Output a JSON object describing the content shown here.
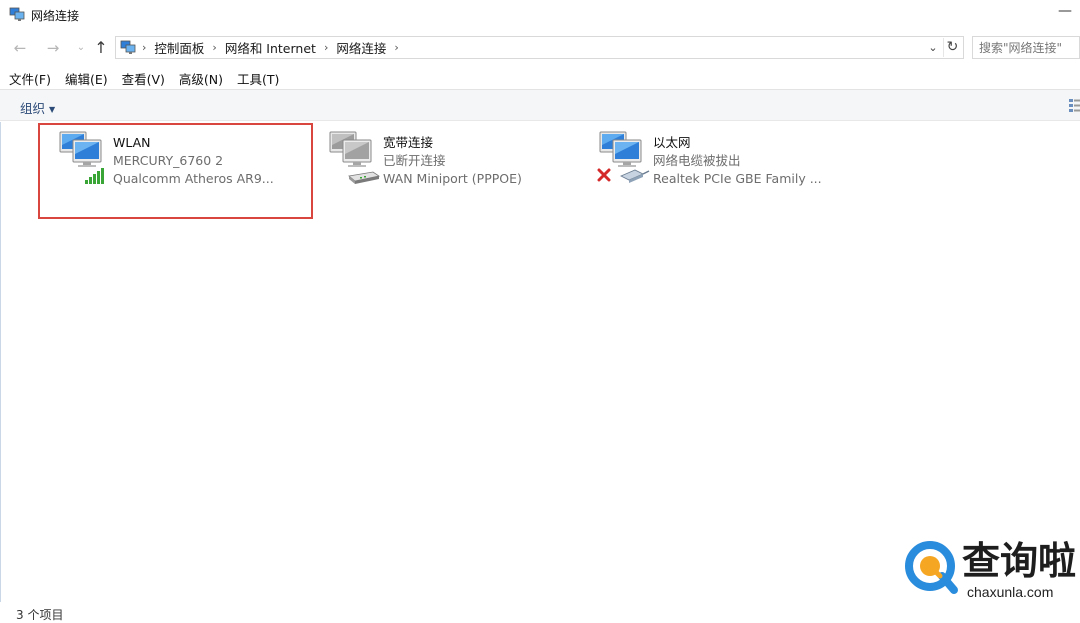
{
  "window": {
    "title": "网络连接",
    "minimize_glyph": "—"
  },
  "nav": {
    "back_glyph": "←",
    "forward_glyph": "→",
    "recent_glyph": "⌄",
    "up_glyph": "↑"
  },
  "address": {
    "crumbs": [
      "控制面板",
      "网络和 Internet",
      "网络连接"
    ],
    "separator": "›",
    "dropdown_glyph": "⌄",
    "refresh_glyph": "↻"
  },
  "search": {
    "placeholder": "搜索\"网络连接\""
  },
  "menu": {
    "items": [
      "文件(F)",
      "编辑(E)",
      "查看(V)",
      "高级(N)",
      "工具(T)"
    ]
  },
  "toolbar": {
    "organize_label": "组织",
    "organize_caret": "▼"
  },
  "connections": [
    {
      "name": "WLAN",
      "status": "MERCURY_6760 2",
      "device": "Qualcomm Atheros AR9...",
      "icon": "wifi-adapter-icon"
    },
    {
      "name": "宽带连接",
      "status": "已断开连接",
      "device": "WAN Miniport (PPPOE)",
      "icon": "broadband-modem-icon"
    },
    {
      "name": "以太网",
      "status": "网络电缆被拔出",
      "device": "Realtek PCIe GBE Family ...",
      "icon": "ethernet-disconnected-icon"
    }
  ],
  "statusbar": {
    "item_count": "3 个项目"
  },
  "watermark": {
    "text": "查询啦",
    "domain": "chaxunla.com"
  },
  "colors": {
    "highlight_border": "#d9463f",
    "monitor_blue": "#2f7fd8",
    "signal_green": "#3aa537",
    "error_red": "#d42a2a",
    "watermark_blue": "#2a8cdc",
    "watermark_orange": "#f5a623"
  }
}
